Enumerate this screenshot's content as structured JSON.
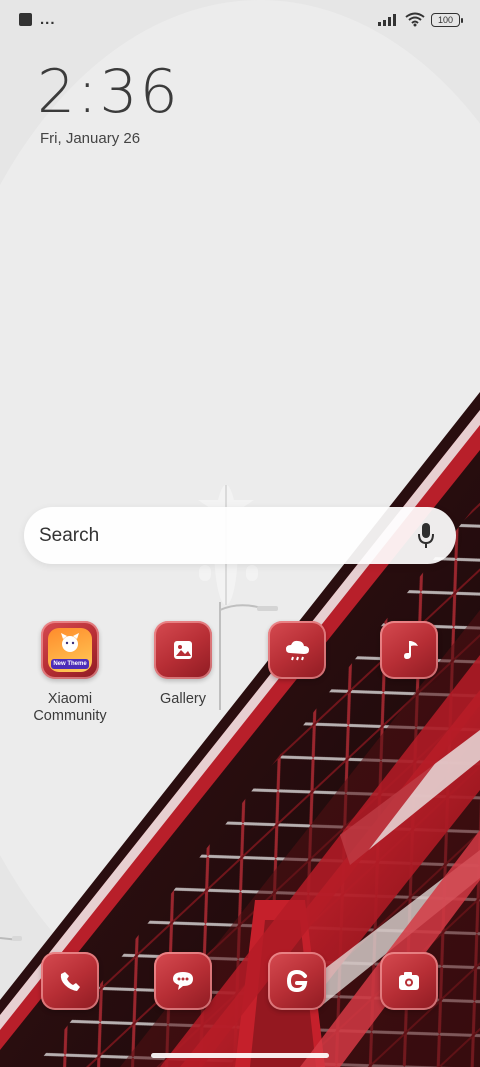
{
  "status_bar": {
    "left_indicators": "...",
    "battery": "100"
  },
  "lock_area": {
    "time": "2:36",
    "date": "Fri, January 26"
  },
  "search": {
    "placeholder": "Search"
  },
  "apps": {
    "xiaomi_community": {
      "label": "Xiaomi Community",
      "badge": "New Theme"
    },
    "gallery": {
      "label": "Gallery"
    },
    "weather": {
      "icon": "weather-icon"
    },
    "music": {
      "icon": "music-icon"
    }
  },
  "dock": {
    "phone": "phone-icon",
    "messages": "messages-icon",
    "google": "google-icon",
    "camera": "camera-icon"
  },
  "colors": {
    "accent_red": "#b72e35",
    "accent_dark_red": "#8e1b22",
    "wallpaper_gray": "#e4e4e4"
  }
}
